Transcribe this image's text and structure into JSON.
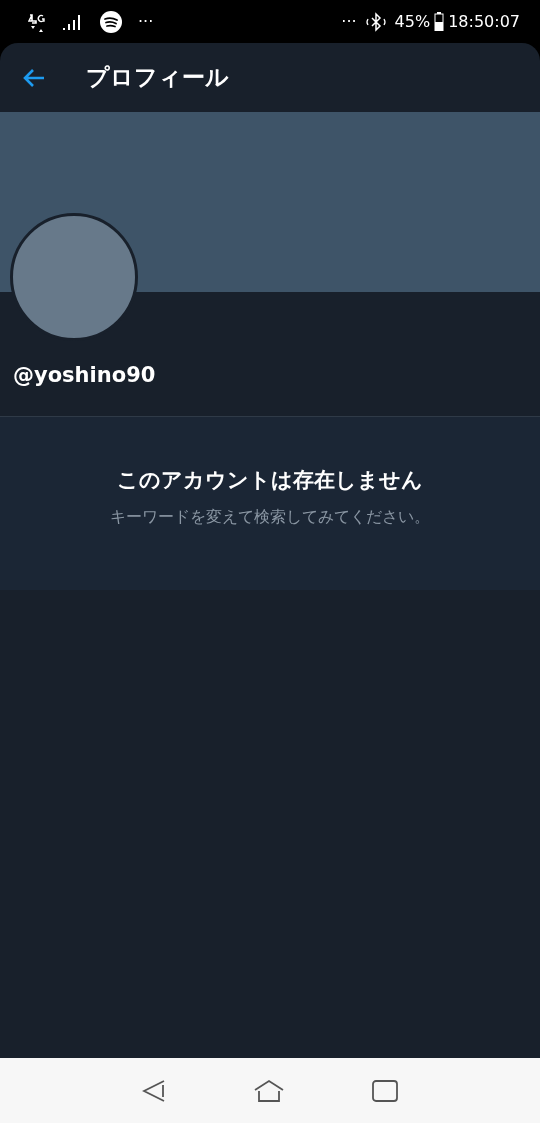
{
  "status_bar": {
    "left_more": "···",
    "right_more": "···",
    "battery": "45%",
    "time": "18:50:07"
  },
  "header": {
    "title": "プロフィール"
  },
  "profile": {
    "handle": "@yoshino90"
  },
  "message": {
    "title": "このアカウントは存在しません",
    "subtitle": "キーワードを変えて検索してみてください。"
  }
}
